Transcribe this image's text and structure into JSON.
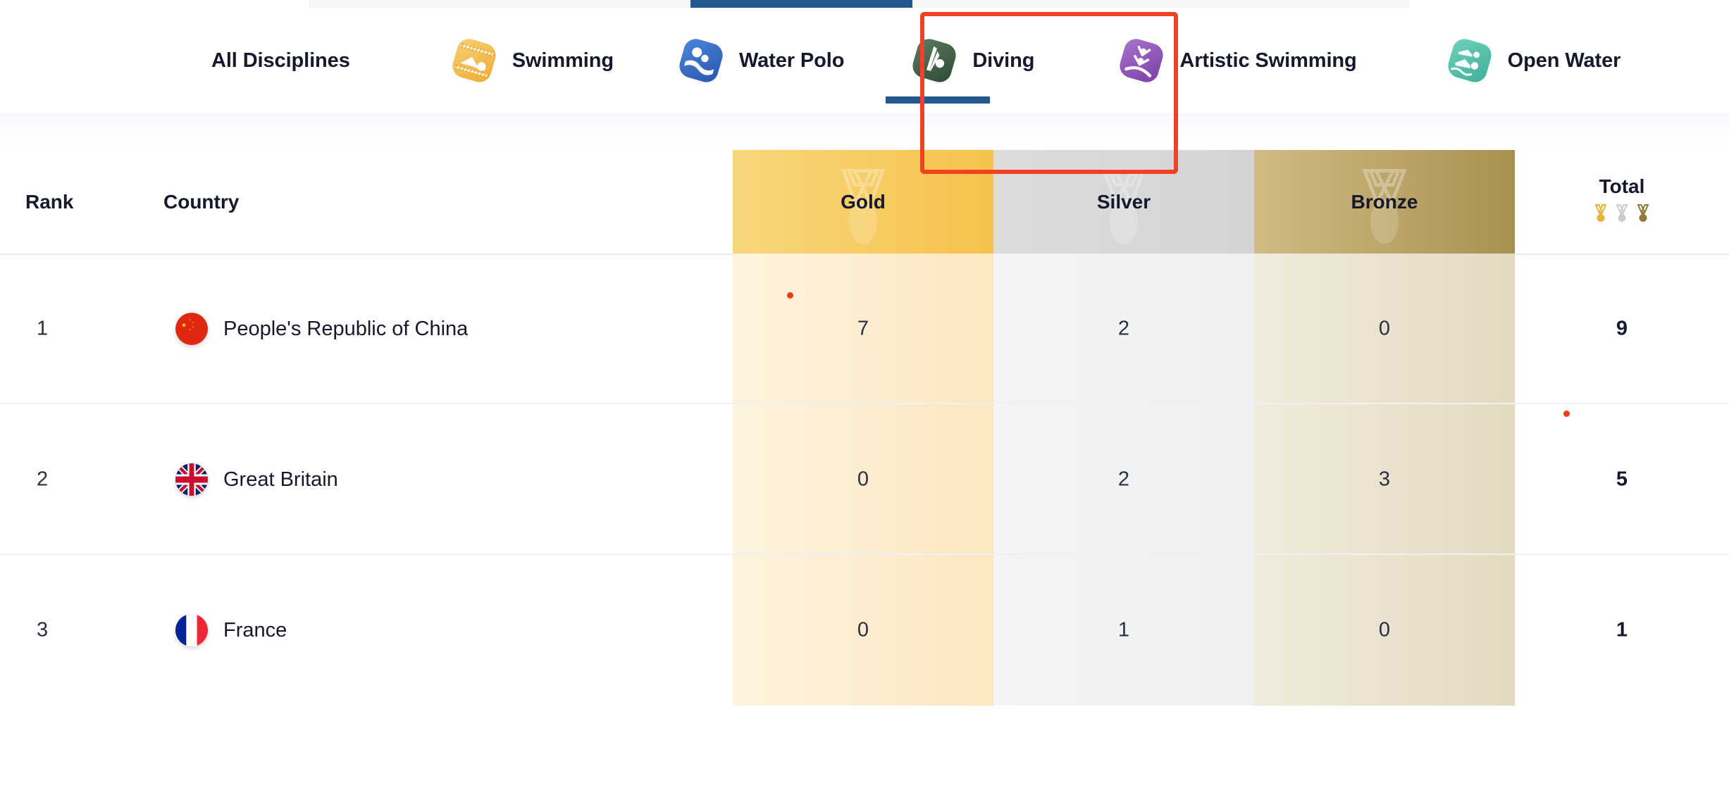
{
  "tabs": [
    {
      "label": "All Disciplines",
      "icon": "none",
      "active": false
    },
    {
      "label": "Swimming",
      "icon": "swimming-icon",
      "active": false
    },
    {
      "label": "Water Polo",
      "icon": "water-polo-icon",
      "active": false
    },
    {
      "label": "Diving",
      "icon": "diving-icon",
      "active": true
    },
    {
      "label": "Artistic Swimming",
      "icon": "artistic-swimming-icon",
      "active": false
    },
    {
      "label": "Open Water",
      "icon": "open-water-icon",
      "active": false
    }
  ],
  "focus": {
    "target_tab": "Diving"
  },
  "table": {
    "columns": [
      "Rank",
      "Country",
      "Gold",
      "Silver",
      "Bronze",
      "Total"
    ],
    "rows": [
      {
        "rank": "1",
        "country": "People's Republic of China",
        "flag": "flag-china",
        "gold": "7",
        "silver": "2",
        "bronze": "0",
        "total": "9"
      },
      {
        "rank": "2",
        "country": "Great Britain",
        "flag": "flag-great-britain",
        "gold": "0",
        "silver": "2",
        "bronze": "3",
        "total": "5"
      },
      {
        "rank": "3",
        "country": "France",
        "flag": "flag-france",
        "gold": "0",
        "silver": "1",
        "bronze": "0",
        "total": "1"
      }
    ]
  },
  "colors": {
    "accent_blue": "#20588f",
    "focus_red": "#f04221",
    "gold": "#f5c24c",
    "silver": "#d4d4d4",
    "bronze": "#a89150",
    "text": "#16192b"
  }
}
